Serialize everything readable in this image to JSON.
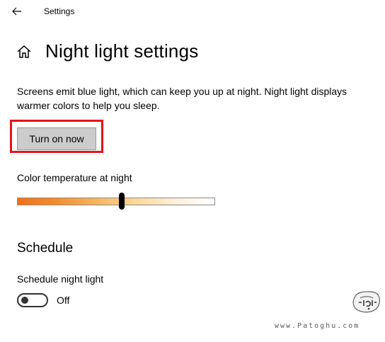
{
  "window": {
    "title": "Settings"
  },
  "icons": {
    "back": "back-arrow-icon",
    "home": "home-icon",
    "watermark": "patoghu-logo-icon"
  },
  "header": {
    "title": "Night light settings"
  },
  "main": {
    "description": "Screens emit blue light, which can keep you up at night. Night light displays warmer colors to help you sleep.",
    "turn_on_button_label": "Turn on now",
    "color_temperature": {
      "label": "Color temperature at night",
      "level": 0.53
    }
  },
  "schedule": {
    "heading": "Schedule",
    "toggle_label": "Schedule night light",
    "toggle_state": "Off",
    "toggle_on": false
  },
  "watermark": {
    "text": "www.Patoghu.com"
  },
  "colors": {
    "highlight": "#e3151a",
    "button_bg": "#cccccc",
    "slider_warm": "#f37017",
    "slider_cool": "#ffffff"
  }
}
